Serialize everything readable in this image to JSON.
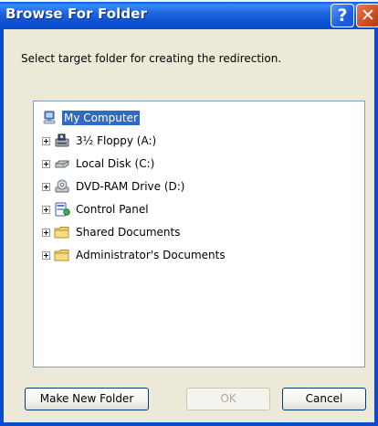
{
  "window": {
    "title": "Browse For Folder",
    "help_glyph": "?",
    "close_glyph": "✕"
  },
  "instruction": "Select target folder for creating the redirection.",
  "tree": {
    "root": {
      "label": "My Computer",
      "icon": "my-computer-icon",
      "selected": true
    },
    "children": [
      {
        "label": "3½ Floppy (A:)",
        "icon": "floppy-drive-icon"
      },
      {
        "label": "Local Disk (C:)",
        "icon": "hard-disk-icon"
      },
      {
        "label": "DVD-RAM Drive (D:)",
        "icon": "dvd-drive-icon"
      },
      {
        "label": "Control Panel",
        "icon": "control-panel-icon"
      },
      {
        "label": "Shared Documents",
        "icon": "folder-icon"
      },
      {
        "label": "Administrator's Documents",
        "icon": "folder-icon"
      }
    ]
  },
  "buttons": {
    "make_new_folder": "Make New Folder",
    "ok": "OK",
    "cancel": "Cancel",
    "ok_enabled": false
  },
  "colors": {
    "titlebar": "#0b4cc9",
    "dialog_bg": "#ece9d8",
    "selection": "#316ac5",
    "close_button": "#d24b20"
  }
}
